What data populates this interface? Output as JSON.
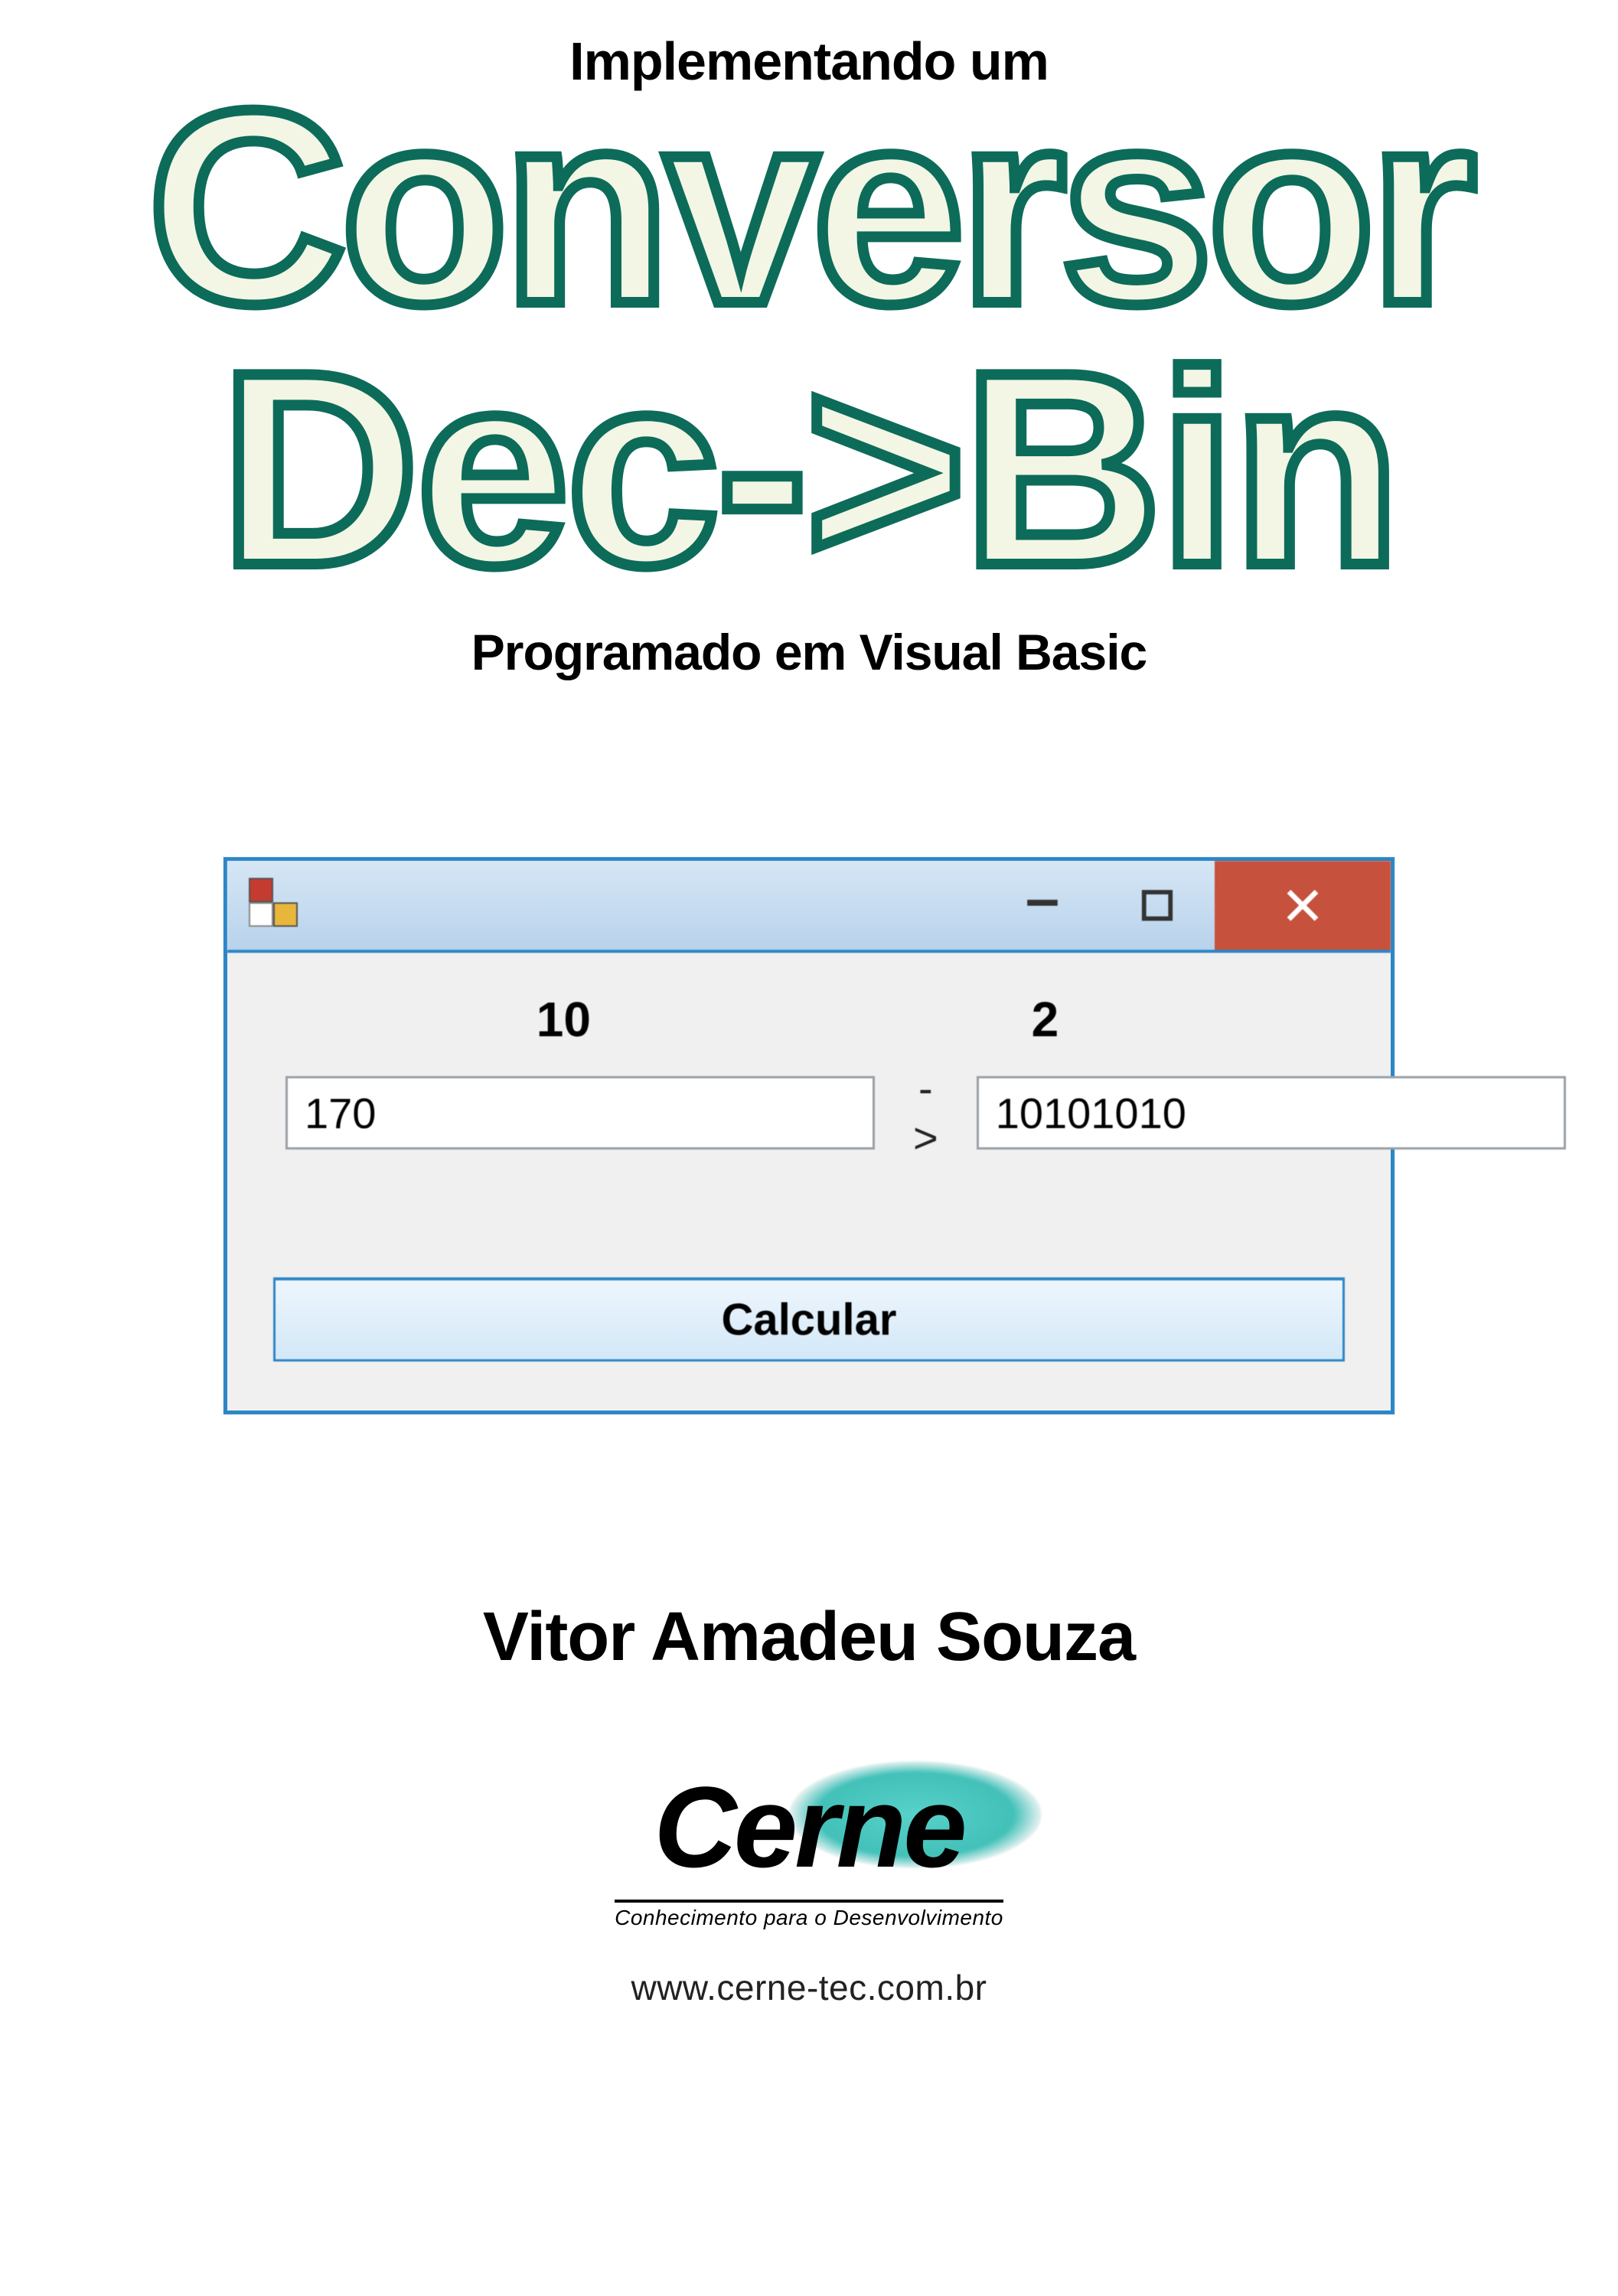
{
  "title": {
    "pre": "Implementando um",
    "line1": "Conversor",
    "line2": "Dec->Bin",
    "post": "Programado em Visual Basic"
  },
  "app_window": {
    "labels": {
      "decimal": "10",
      "binary": "2"
    },
    "arrow": "->",
    "input_decimal": "170",
    "input_binary": "10101010",
    "button": "Calcular"
  },
  "author": "Vitor Amadeu Souza",
  "logo": {
    "name": "Cerne",
    "tagline": "Conhecimento para o Desenvolvimento",
    "url": "www.cerne-tec.com.br"
  }
}
